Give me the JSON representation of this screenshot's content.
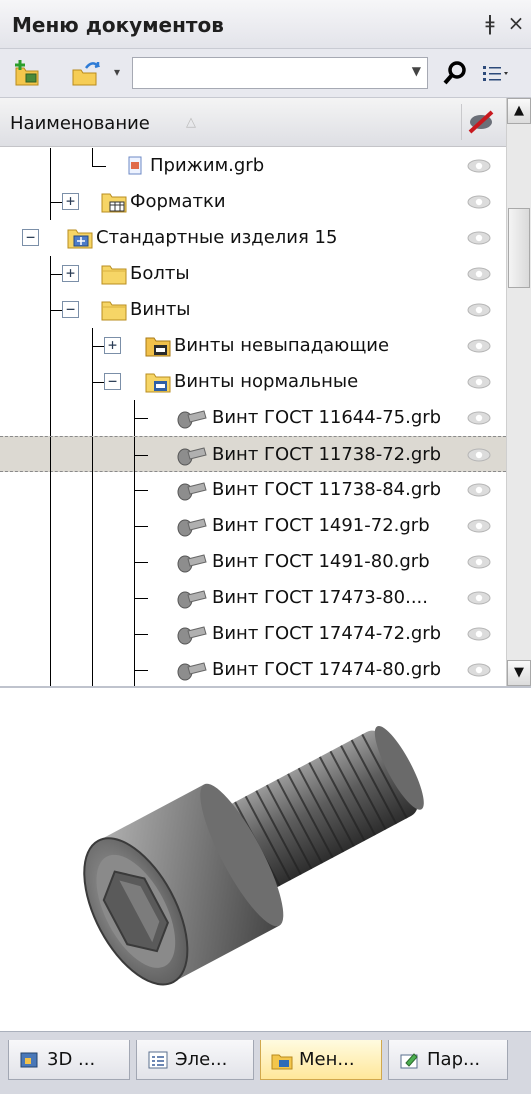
{
  "panel": {
    "title": "Меню документов",
    "pin_glyph": "⇩",
    "close_glyph": "×"
  },
  "toolbar": {
    "new_folder_icon": "add-folder-icon",
    "open_icon": "open-folder-icon",
    "search_value": "",
    "search_icon": "search-icon",
    "view_icon": "list-view-icon"
  },
  "tree": {
    "column_header": "Наименование",
    "visibility_icon": "eye-strikethrough-icon",
    "rows": [
      {
        "label": "Прижим.grb"
      },
      {
        "label": "Форматки"
      },
      {
        "label": "Стандартные изделия 15"
      },
      {
        "label": "Болты"
      },
      {
        "label": "Винты"
      },
      {
        "label": "Винты невыпадающие"
      },
      {
        "label": "Винты нормальные"
      },
      {
        "label": "Винт ГОСТ 11644-75.grb"
      },
      {
        "label": "Винт ГОСТ 11738-72.grb",
        "selected": true
      },
      {
        "label": "Винт ГОСТ 11738-84.grb"
      },
      {
        "label": "Винт ГОСТ 1491-72.grb"
      },
      {
        "label": "Винт ГОСТ 1491-80.grb"
      },
      {
        "label": "Винт ГОСТ 17473-80...."
      },
      {
        "label": "Винт ГОСТ 17474-72.grb"
      },
      {
        "label": "Винт ГОСТ 17474-80.grb"
      }
    ]
  },
  "preview": {
    "subject": "socket-head-cap-screw-3d-preview"
  },
  "tabs": [
    {
      "label": "3D ...",
      "icon": "3d-model-icon"
    },
    {
      "label": "Эле...",
      "icon": "elements-icon"
    },
    {
      "label": "Мен...",
      "icon": "documents-menu-icon",
      "active": true
    },
    {
      "label": "Пар...",
      "icon": "parameters-icon"
    }
  ]
}
